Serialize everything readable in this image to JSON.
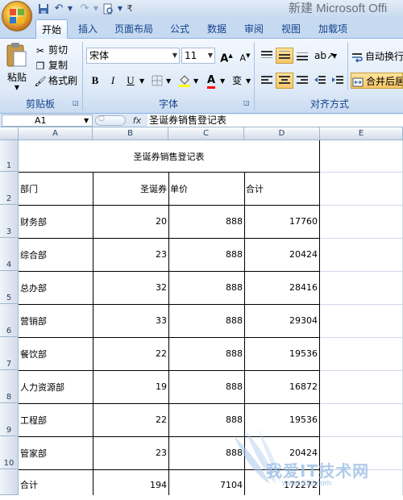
{
  "window": {
    "title": "新建 Microsoft Offi",
    "qat_more": "₹"
  },
  "tabs": [
    {
      "label": "开始"
    },
    {
      "label": "插入"
    },
    {
      "label": "页面布局"
    },
    {
      "label": "公式"
    },
    {
      "label": "数据"
    },
    {
      "label": "审阅"
    },
    {
      "label": "视图"
    },
    {
      "label": "加载项"
    }
  ],
  "clipboard": {
    "paste_label": "粘贴",
    "cut_label": "剪切",
    "copy_label": "复制",
    "format_painter_label": "格式刷",
    "group_label": "剪贴板"
  },
  "font": {
    "name": "宋体",
    "size": "11",
    "bold": "B",
    "italic": "I",
    "underline": "U",
    "font_color_glyph": "A",
    "phonetic_glyph": "变",
    "grow_glyph": "A",
    "shrink_glyph": "A",
    "group_label": "字体"
  },
  "alignment": {
    "wrap_text_label": "自动换行",
    "merge_center_label": "合并后居",
    "group_label": "对齐方式"
  },
  "formula_bar": {
    "cell_ref": "A1",
    "fx_label": "fx",
    "content": "圣诞券销售登记表"
  },
  "sheet": {
    "columns": [
      "A",
      "B",
      "C",
      "D",
      "E"
    ],
    "title": "圣诞券销售登记表",
    "header": {
      "dept": "部门",
      "qty": "圣诞券",
      "price": "单价",
      "total": "合计"
    },
    "rows": [
      {
        "row": "1"
      },
      {
        "row": "2"
      },
      {
        "row": "3",
        "dept": "财务部",
        "qty": "20",
        "price": "888",
        "total": "17760"
      },
      {
        "row": "4",
        "dept": "综合部",
        "qty": "23",
        "price": "888",
        "total": "20424"
      },
      {
        "row": "5",
        "dept": "总办部",
        "qty": "32",
        "price": "888",
        "total": "28416"
      },
      {
        "row": "6",
        "dept": "营销部",
        "qty": "33",
        "price": "888",
        "total": "29304"
      },
      {
        "row": "7",
        "dept": "餐饮部",
        "qty": "22",
        "price": "888",
        "total": "19536"
      },
      {
        "row": "8",
        "dept": "人力资源部",
        "qty": "19",
        "price": "888",
        "total": "16872"
      },
      {
        "row": "9",
        "dept": "工程部",
        "qty": "22",
        "price": "888",
        "total": "19536"
      },
      {
        "row": "10",
        "dept": "管家部",
        "qty": "23",
        "price": "888",
        "total": "20424"
      }
    ],
    "totals": {
      "dept": "合计",
      "qty": "194",
      "price": "7104",
      "total": "172272"
    }
  },
  "watermark": {
    "text": "我爱IT技术网",
    "url": "www.52ij.com"
  },
  "colors": {
    "ribbon_bg": "#dde9f7",
    "tab_text": "#15428b",
    "grid_line": "#d0d7e5",
    "cell_border": "#000000"
  }
}
